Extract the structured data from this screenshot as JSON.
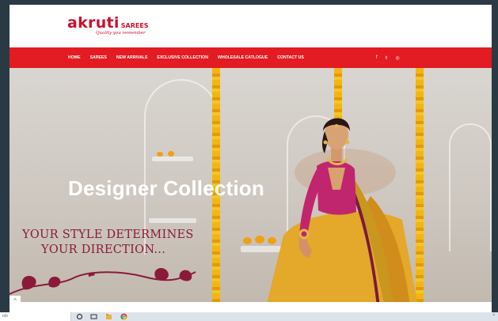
{
  "site": {
    "logo_word": "akruti",
    "logo_suffix": "SAREES",
    "logo_tagline": "Quality  you remember"
  },
  "nav": {
    "items": [
      "HOME",
      "SAREES",
      "NEW ARRIVALS",
      "EXCLUSIVE COLLECTION",
      "WHOLESALE CATLOGUE",
      "CONTACT US"
    ],
    "social": [
      "f",
      "𝕥",
      "◎"
    ]
  },
  "hero": {
    "title": "Designer Collection",
    "tagline_line1": "YOUR STYLE DETERMINES",
    "tagline_line2": "YOUR DIRECTION..."
  },
  "taskbar": {
    "search_fragment": "rch"
  },
  "colors": {
    "brand_red": "#e31b23",
    "logo_red": "#c8102e",
    "tagline_maroon": "#8b1a3a",
    "saree_mustard": "#e4a82a",
    "blouse_magenta": "#c0266d"
  }
}
